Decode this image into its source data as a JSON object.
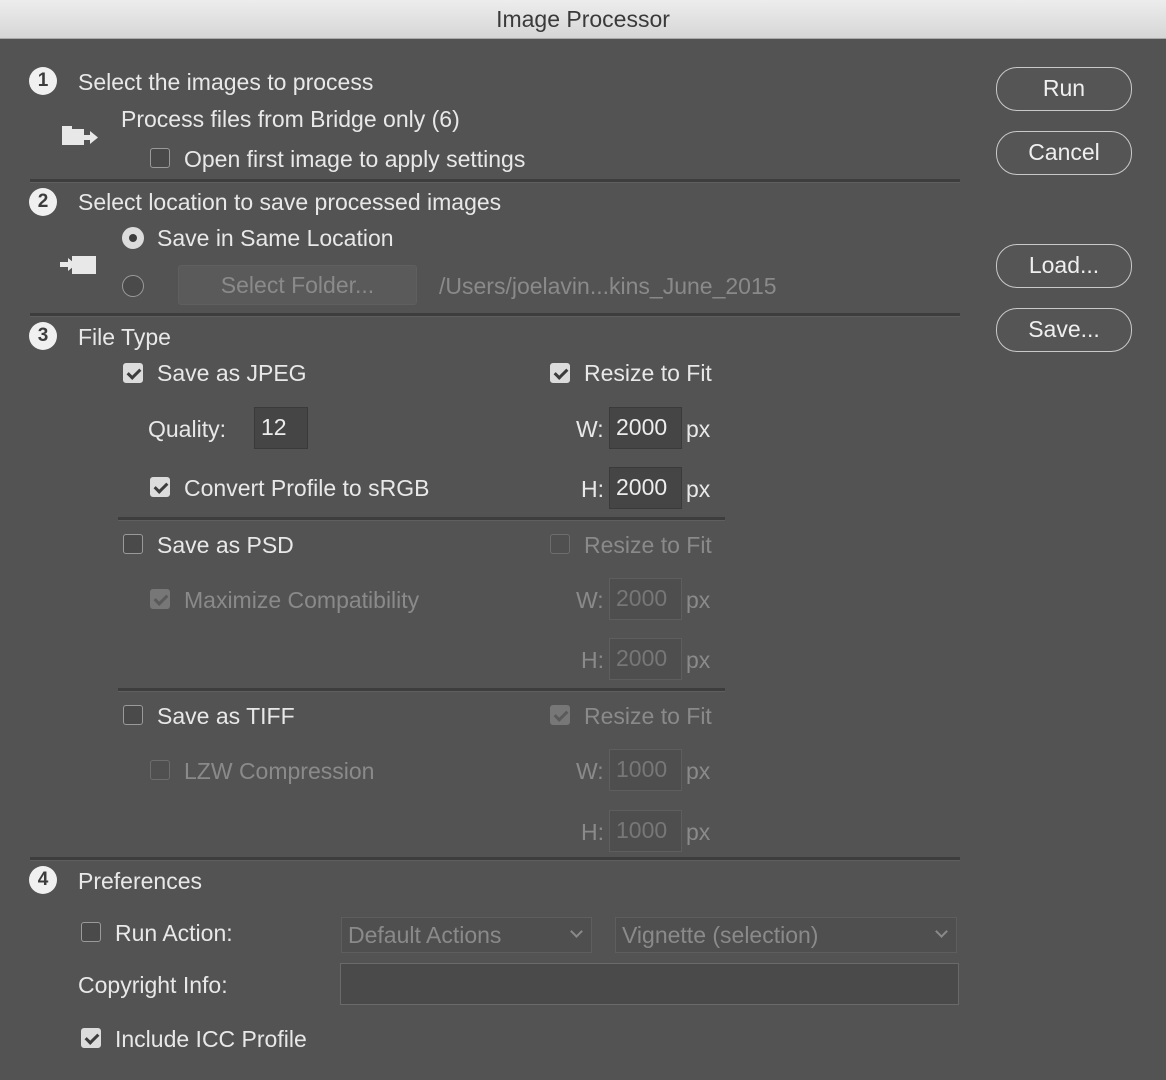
{
  "window": {
    "title": "Image Processor"
  },
  "buttons": {
    "run": "Run",
    "cancel": "Cancel",
    "load": "Load...",
    "save": "Save..."
  },
  "section1": {
    "number": "1",
    "heading": "Select the images to process",
    "source": "Process files from Bridge only (6)",
    "open_first": {
      "label": "Open first image to apply settings",
      "checked": false
    }
  },
  "section2": {
    "number": "2",
    "heading": "Select location to save processed images",
    "same_location": {
      "label": "Save in Same Location",
      "selected": true
    },
    "select_folder": {
      "label": "Select Folder...",
      "path": "/Users/joelavin...kins_June_2015",
      "selected": false
    }
  },
  "section3": {
    "number": "3",
    "heading": "File Type",
    "jpeg": {
      "label": "Save as JPEG",
      "checked": true,
      "quality_label": "Quality:",
      "quality": "12",
      "convert_label": "Convert Profile to sRGB",
      "convert_checked": true,
      "resize_label": "Resize to Fit",
      "resize_checked": true,
      "w_label": "W:",
      "w": "2000",
      "h_label": "H:",
      "h": "2000",
      "unit": "px"
    },
    "psd": {
      "label": "Save as PSD",
      "checked": false,
      "maximize_label": "Maximize Compatibility",
      "maximize_checked": true,
      "resize_label": "Resize to Fit",
      "resize_checked": false,
      "w_label": "W:",
      "w": "2000",
      "h_label": "H:",
      "h": "2000",
      "unit": "px"
    },
    "tiff": {
      "label": "Save as TIFF",
      "checked": false,
      "lzw_label": "LZW Compression",
      "lzw_checked": false,
      "resize_label": "Resize to Fit",
      "resize_checked": true,
      "w_label": "W:",
      "w": "1000",
      "h_label": "H:",
      "h": "1000",
      "unit": "px"
    }
  },
  "section4": {
    "number": "4",
    "heading": "Preferences",
    "run_action": {
      "label": "Run Action:",
      "checked": false,
      "set": "Default Actions",
      "action": "Vignette (selection)"
    },
    "copyright": {
      "label": "Copyright Info:",
      "value": ""
    },
    "icc": {
      "label": "Include ICC Profile",
      "checked": true
    }
  },
  "colors": {
    "panel": "#535353",
    "titlebar": "#e4e4e4",
    "text": "#e8e8e8",
    "disabled_text": "#8a8a8a"
  }
}
